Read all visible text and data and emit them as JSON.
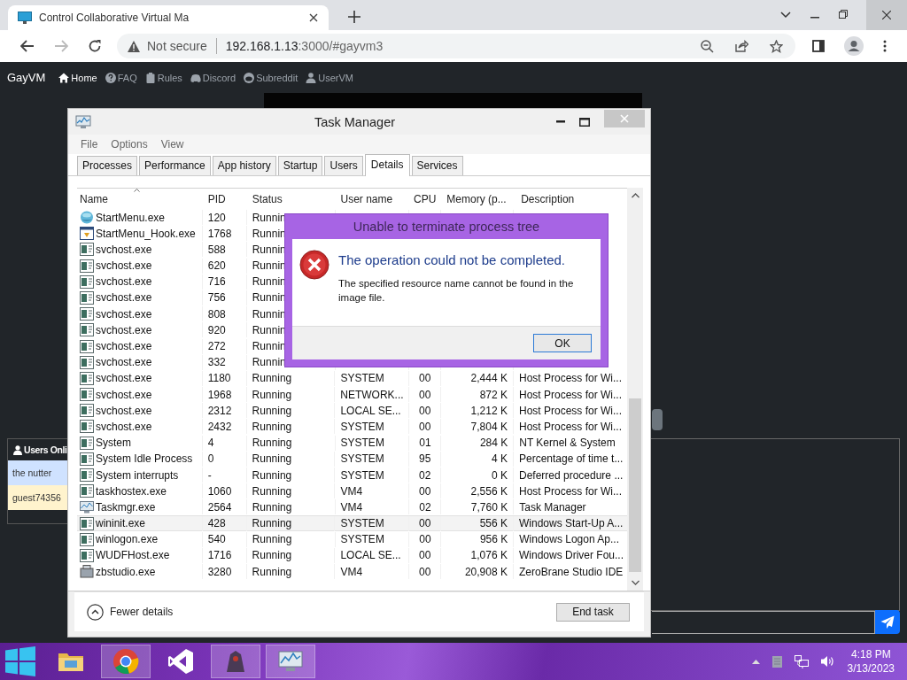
{
  "browser": {
    "tab": {
      "title": "Control Collaborative Virtual Ma"
    },
    "address": {
      "security": "Not secure",
      "host": "192.168.1.13",
      "path": ":3000/#gayvm3"
    }
  },
  "site_nav": {
    "brand": "GayVM",
    "items": [
      {
        "label": "Home",
        "kind": "home",
        "selected": true
      },
      {
        "label": "FAQ",
        "kind": "faq",
        "selected": false
      },
      {
        "label": "Rules",
        "kind": "rules",
        "selected": false
      },
      {
        "label": "Discord",
        "kind": "discord",
        "selected": false
      },
      {
        "label": "Subreddit",
        "kind": "subreddit",
        "selected": false
      },
      {
        "label": "UserVM",
        "kind": "user",
        "selected": false
      }
    ]
  },
  "users_online": {
    "title": "Users Onli",
    "users": [
      {
        "name": "the nutter",
        "color": "#cfe2ff"
      },
      {
        "name": "guest74356",
        "color": "#fff3cd"
      }
    ]
  },
  "task_manager": {
    "title": "Task Manager",
    "menu": [
      "File",
      "Options",
      "View"
    ],
    "tabs": [
      {
        "label": "Processes",
        "selected": false
      },
      {
        "label": "Performance",
        "selected": false
      },
      {
        "label": "App history",
        "selected": false
      },
      {
        "label": "Startup",
        "selected": false
      },
      {
        "label": "Users",
        "selected": false
      },
      {
        "label": "Details",
        "selected": true
      },
      {
        "label": "Services",
        "selected": false
      }
    ],
    "columns": [
      "Name",
      "PID",
      "Status",
      "User name",
      "CPU",
      "Memory (p...",
      "Description"
    ],
    "rows": [
      {
        "kind": "globe",
        "name": "StartMenu.exe",
        "pid": "120",
        "status": "Runnin",
        "selected": false
      },
      {
        "kind": "hook",
        "name": "StartMenu_Hook.exe",
        "pid": "1768",
        "status": "Runnin",
        "selected": false
      },
      {
        "kind": "exe",
        "name": "svchost.exe",
        "pid": "588",
        "status": "Runnin",
        "selected": false
      },
      {
        "kind": "exe",
        "name": "svchost.exe",
        "pid": "620",
        "status": "Runnin",
        "selected": false
      },
      {
        "kind": "exe",
        "name": "svchost.exe",
        "pid": "716",
        "status": "Runnin",
        "selected": false
      },
      {
        "kind": "exe",
        "name": "svchost.exe",
        "pid": "756",
        "status": "Runnin",
        "selected": false
      },
      {
        "kind": "exe",
        "name": "svchost.exe",
        "pid": "808",
        "status": "Runnin",
        "selected": false
      },
      {
        "kind": "exe",
        "name": "svchost.exe",
        "pid": "920",
        "status": "Runnin",
        "selected": false
      },
      {
        "kind": "exe",
        "name": "svchost.exe",
        "pid": "272",
        "status": "Runnin",
        "selected": false
      },
      {
        "kind": "exe",
        "name": "svchost.exe",
        "pid": "332",
        "status": "Runnin",
        "selected": false
      },
      {
        "kind": "exe",
        "name": "svchost.exe",
        "pid": "1180",
        "status": "Running",
        "user": "SYSTEM",
        "cpu": "00",
        "memory": "2,444 K",
        "description": "Host Process for Wi...",
        "selected": false
      },
      {
        "kind": "exe",
        "name": "svchost.exe",
        "pid": "1968",
        "status": "Running",
        "user": "NETWORK...",
        "cpu": "00",
        "memory": "872 K",
        "description": "Host Process for Wi...",
        "selected": false
      },
      {
        "kind": "exe",
        "name": "svchost.exe",
        "pid": "2312",
        "status": "Running",
        "user": "LOCAL SE...",
        "cpu": "00",
        "memory": "1,212 K",
        "description": "Host Process for Wi...",
        "selected": false
      },
      {
        "kind": "exe",
        "name": "svchost.exe",
        "pid": "2432",
        "status": "Running",
        "user": "SYSTEM",
        "cpu": "00",
        "memory": "7,804 K",
        "description": "Host Process for Wi...",
        "selected": false
      },
      {
        "kind": "exe",
        "name": "System",
        "pid": "4",
        "status": "Running",
        "user": "SYSTEM",
        "cpu": "01",
        "memory": "284 K",
        "description": "NT Kernel & System",
        "selected": false
      },
      {
        "kind": "exe",
        "name": "System Idle Process",
        "pid": "0",
        "status": "Running",
        "user": "SYSTEM",
        "cpu": "95",
        "memory": "4 K",
        "description": "Percentage of time t...",
        "selected": false
      },
      {
        "kind": "exe",
        "name": "System interrupts",
        "pid": "-",
        "status": "Running",
        "user": "SYSTEM",
        "cpu": "02",
        "memory": "0 K",
        "description": "Deferred procedure ...",
        "selected": false
      },
      {
        "kind": "exe",
        "name": "taskhostex.exe",
        "pid": "1060",
        "status": "Running",
        "user": "VM4",
        "cpu": "00",
        "memory": "2,556 K",
        "description": "Host Process for Wi...",
        "selected": false
      },
      {
        "kind": "taskmgr",
        "name": "Taskmgr.exe",
        "pid": "2564",
        "status": "Running",
        "user": "VM4",
        "cpu": "02",
        "memory": "7,760 K",
        "description": "Task Manager",
        "selected": false
      },
      {
        "kind": "exe",
        "name": "wininit.exe",
        "pid": "428",
        "status": "Running",
        "user": "SYSTEM",
        "cpu": "00",
        "memory": "556 K",
        "description": "Windows Start-Up A...",
        "selected": true
      },
      {
        "kind": "exe",
        "name": "winlogon.exe",
        "pid": "540",
        "status": "Running",
        "user": "SYSTEM",
        "cpu": "00",
        "memory": "956 K",
        "description": "Windows Logon Ap...",
        "selected": false
      },
      {
        "kind": "exe",
        "name": "WUDFHost.exe",
        "pid": "1716",
        "status": "Running",
        "user": "LOCAL SE...",
        "cpu": "00",
        "memory": "1,076 K",
        "description": "Windows Driver Fou...",
        "selected": false
      },
      {
        "kind": "zb",
        "name": "zbstudio.exe",
        "pid": "3280",
        "status": "Running",
        "user": "VM4",
        "cpu": "00",
        "memory": "20,908 K",
        "description": "ZeroBrane Studio IDE",
        "selected": false
      }
    ],
    "footer": {
      "toggle": "Fewer details",
      "button": "End task"
    }
  },
  "dialog": {
    "title": "Unable to terminate process tree",
    "heading": "The operation could not be completed.",
    "message": "The specified resource name cannot be found in the image file.",
    "button": "OK"
  },
  "taskbar": {
    "apps": [
      {
        "kind": "explorer",
        "running": false
      },
      {
        "kind": "chrome",
        "running": true
      },
      {
        "kind": "studio",
        "running": false
      },
      {
        "kind": "dark-app",
        "running": true
      },
      {
        "kind": "taskmgr",
        "running": true
      }
    ],
    "time": "4:18 PM",
    "date": "3/13/2023"
  }
}
